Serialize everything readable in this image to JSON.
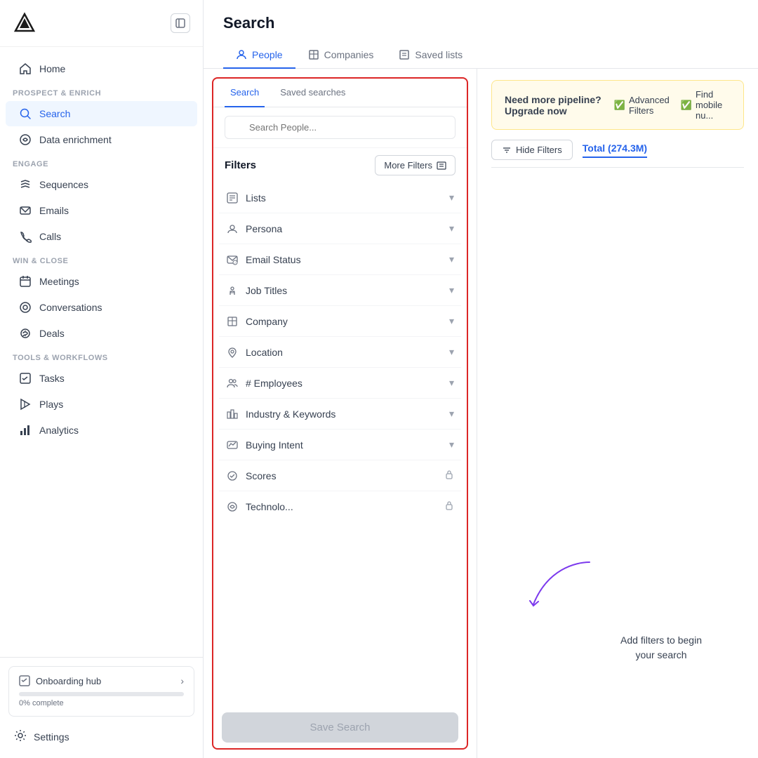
{
  "app": {
    "logo_text": "▲"
  },
  "sidebar": {
    "sections": [
      {
        "label": "Prospect & enrich",
        "items": [
          {
            "id": "search",
            "label": "Search",
            "icon": "search",
            "active": true
          },
          {
            "id": "data-enrichment",
            "label": "Data enrichment",
            "icon": "enrich",
            "active": false
          }
        ]
      },
      {
        "label": "Engage",
        "items": [
          {
            "id": "sequences",
            "label": "Sequences",
            "icon": "sequences",
            "active": false
          },
          {
            "id": "emails",
            "label": "Emails",
            "icon": "emails",
            "active": false
          },
          {
            "id": "calls",
            "label": "Calls",
            "icon": "calls",
            "active": false
          }
        ]
      },
      {
        "label": "Win & close",
        "items": [
          {
            "id": "meetings",
            "label": "Meetings",
            "icon": "meetings",
            "active": false
          },
          {
            "id": "conversations",
            "label": "Conversations",
            "icon": "conversations",
            "active": false
          },
          {
            "id": "deals",
            "label": "Deals",
            "icon": "deals",
            "active": false
          }
        ]
      },
      {
        "label": "Tools & workflows",
        "items": [
          {
            "id": "tasks",
            "label": "Tasks",
            "icon": "tasks",
            "active": false
          },
          {
            "id": "plays",
            "label": "Plays",
            "icon": "plays",
            "active": false
          },
          {
            "id": "analytics",
            "label": "Analytics",
            "icon": "analytics",
            "active": false
          }
        ]
      }
    ],
    "home_label": "Home",
    "onboarding_label": "Onboarding hub",
    "onboarding_progress": "0% complete",
    "onboarding_chevron": ">",
    "settings_label": "Settings"
  },
  "main": {
    "title": "Search",
    "tabs": [
      {
        "id": "people",
        "label": "People",
        "icon": "people",
        "active": true
      },
      {
        "id": "companies",
        "label": "Companies",
        "icon": "companies",
        "active": false
      },
      {
        "id": "saved-lists",
        "label": "Saved lists",
        "icon": "saved-lists",
        "active": false
      }
    ]
  },
  "filter_panel": {
    "tabs": [
      {
        "id": "search",
        "label": "Search",
        "active": true
      },
      {
        "id": "saved-searches",
        "label": "Saved searches",
        "active": false
      }
    ],
    "search_placeholder": "Search People...",
    "filters_label": "Filters",
    "more_filters_label": "More Filters",
    "filter_items": [
      {
        "id": "lists",
        "label": "Lists",
        "icon": "list",
        "locked": false
      },
      {
        "id": "persona",
        "label": "Persona",
        "icon": "persona",
        "locked": false
      },
      {
        "id": "email-status",
        "label": "Email Status",
        "icon": "email-status",
        "locked": false
      },
      {
        "id": "job-titles",
        "label": "Job Titles",
        "icon": "job-titles",
        "locked": false
      },
      {
        "id": "company",
        "label": "Company",
        "icon": "company",
        "locked": false
      },
      {
        "id": "location",
        "label": "Location",
        "icon": "location",
        "locked": false
      },
      {
        "id": "employees",
        "label": "# Employees",
        "icon": "employees",
        "locked": false
      },
      {
        "id": "industry-keywords",
        "label": "Industry & Keywords",
        "icon": "industry",
        "locked": false
      },
      {
        "id": "buying-intent",
        "label": "Buying Intent",
        "icon": "buying-intent",
        "locked": false
      },
      {
        "id": "scores",
        "label": "Scores",
        "icon": "scores",
        "locked": true
      },
      {
        "id": "technolo",
        "label": "Technolo...",
        "icon": "tech",
        "locked": true
      }
    ],
    "save_search_label": "Save Search"
  },
  "results": {
    "hide_filters_label": "Hide Filters",
    "total_label": "Total (274.3M)",
    "upgrade_text": "Need more pipeline? Upgrade now",
    "feature1": "Advanced Filters",
    "feature2": "Find mobile nu...",
    "empty_text": "Add filters to begin\nyour search"
  }
}
